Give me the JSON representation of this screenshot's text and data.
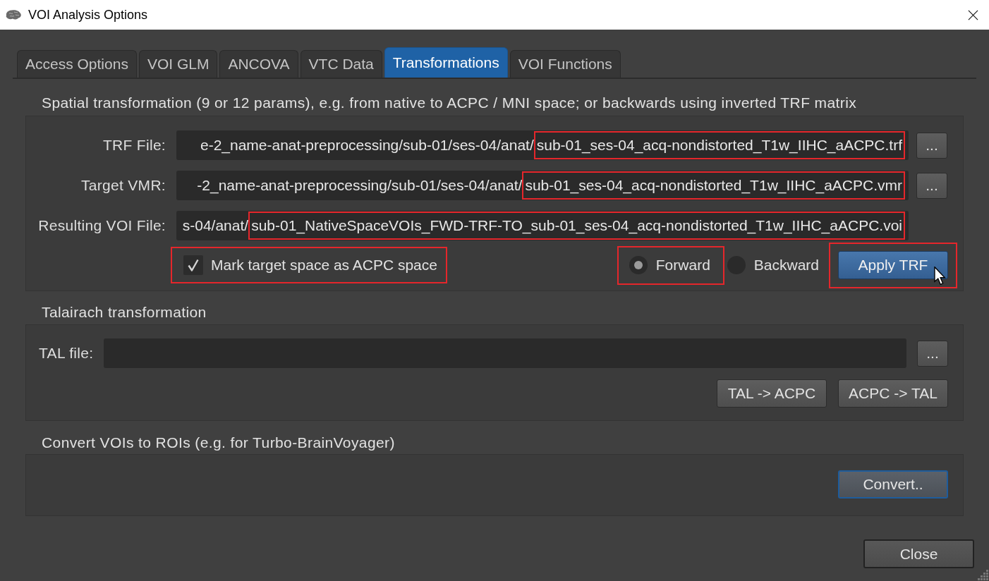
{
  "window": {
    "title": "VOI Analysis Options"
  },
  "tabs": [
    {
      "label": "Access Options",
      "selected": false
    },
    {
      "label": "VOI GLM",
      "selected": false
    },
    {
      "label": "ANCOVA",
      "selected": false
    },
    {
      "label": "VTC Data",
      "selected": false
    },
    {
      "label": "Transformations",
      "selected": true
    },
    {
      "label": "VOI Functions",
      "selected": false
    }
  ],
  "spatial_transformation": {
    "heading": "Spatial transformation (9 or 12 params), e.g. from native to ACPC / MNI space; or backwards using inverted TRF matrix",
    "files": [
      {
        "label": "TRF File:",
        "value_path": "e-2_name-anat-preprocessing/sub-01/ses-04/anat/",
        "value_file": "sub-01_ses-04_acq-nondistorted_T1w_IIHC_aACPC.trf",
        "highlighted": true,
        "browse_button": "..."
      },
      {
        "label": "Target VMR:",
        "value_path": "-2_name-anat-preprocessing/sub-01/ses-04/anat/",
        "value_file": "sub-01_ses-04_acq-nondistorted_T1w_IIHC_aACPC.vmr",
        "highlighted": true,
        "browse_button": "..."
      },
      {
        "label": "Resulting VOI File:",
        "value_path": "s-04/anat/",
        "value_file": "sub-01_NativeSpaceVOIs_FWD-TRF-TO_sub-01_ses-04_acq-nondistorted_T1w_IIHC_aACPC.voi",
        "highlighted": true
      }
    ],
    "mark_acpc": {
      "label": "Mark target space as ACPC space",
      "checked": true,
      "highlighted": true
    },
    "direction": [
      {
        "label": "Forward",
        "selected": true,
        "highlighted": true
      },
      {
        "label": "Backward",
        "selected": false,
        "highlighted": false
      }
    ],
    "apply_button": {
      "label": "Apply TRF",
      "highlighted": true
    }
  },
  "talairach": {
    "heading": "Talairach transformation",
    "file_label": "TAL file:",
    "browse_button": "...",
    "buttons": [
      "TAL -> ACPC",
      "ACPC -> TAL"
    ]
  },
  "convert": {
    "heading": "Convert VOIs to ROIs (e.g. for Turbo-BrainVoyager)",
    "button": {
      "label": "Convert..",
      "default": true
    }
  },
  "close_button": "Close"
}
